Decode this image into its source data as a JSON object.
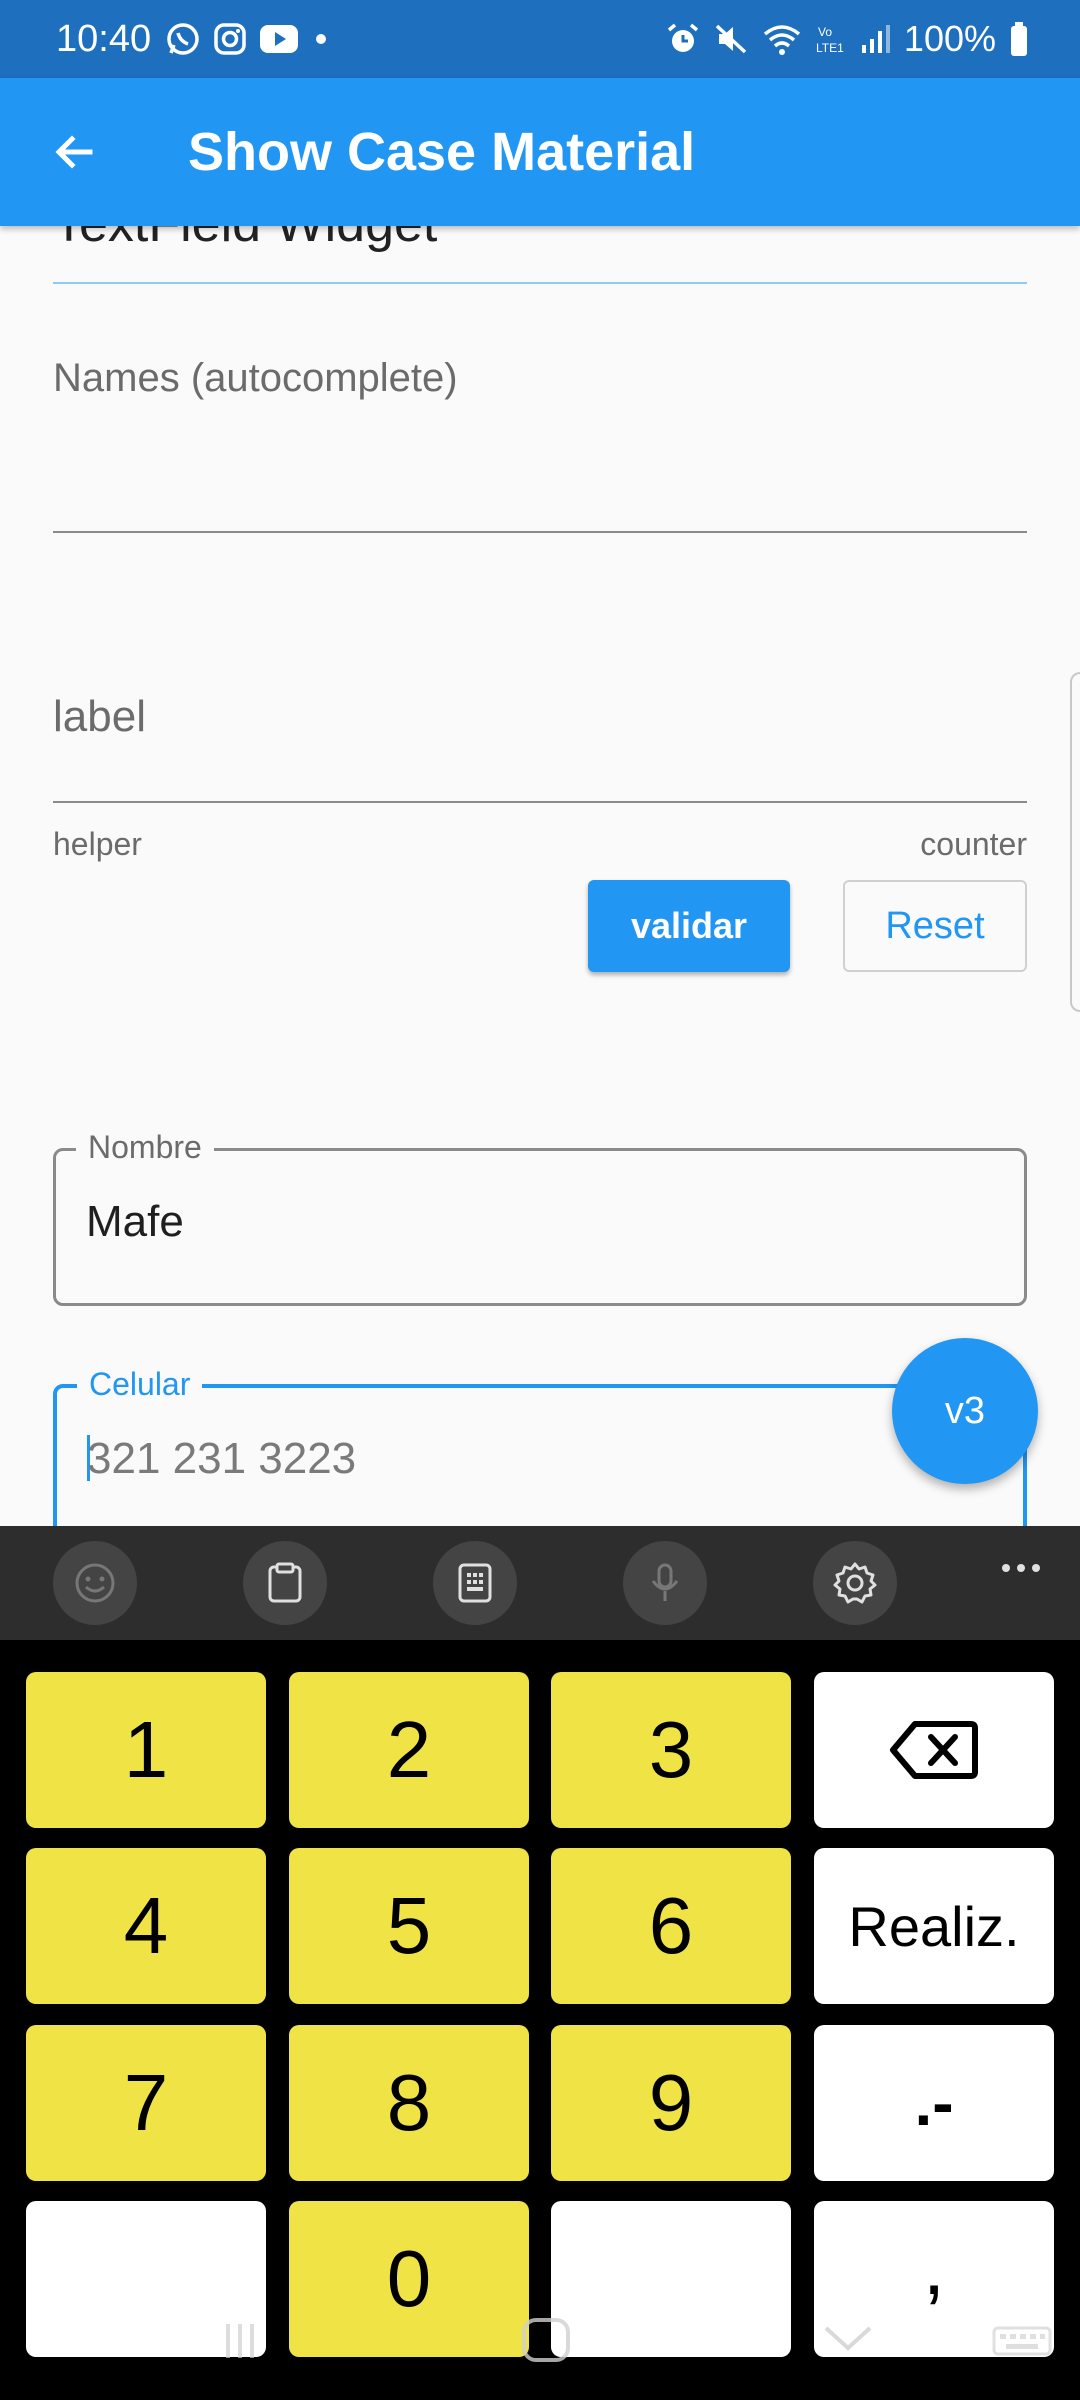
{
  "status_bar": {
    "time": "10:40",
    "battery": "100%"
  },
  "app_bar": {
    "title": "Show Case Material"
  },
  "section": {
    "title": "TextField Widget"
  },
  "autocomplete_field": {
    "label": "Names (autocomplete)"
  },
  "label_field": {
    "label": "label",
    "helper": "helper",
    "counter": "counter"
  },
  "buttons": {
    "validar": "validar",
    "reset": "Reset"
  },
  "nombre_field": {
    "label": "Nombre",
    "value": "Mafe"
  },
  "celular_field": {
    "label": "Celular",
    "hint": "321 231 3223"
  },
  "fab": {
    "label": "v3"
  },
  "keyboard": {
    "keys": [
      "1",
      "2",
      "3",
      "4",
      "5",
      "6",
      "Realiz.",
      "7",
      "8",
      "9",
      ".-",
      "0",
      ","
    ]
  },
  "colors": {
    "primary": "#2196f3",
    "status_bar": "#1e6fbd",
    "key_yellow": "#efe346"
  }
}
